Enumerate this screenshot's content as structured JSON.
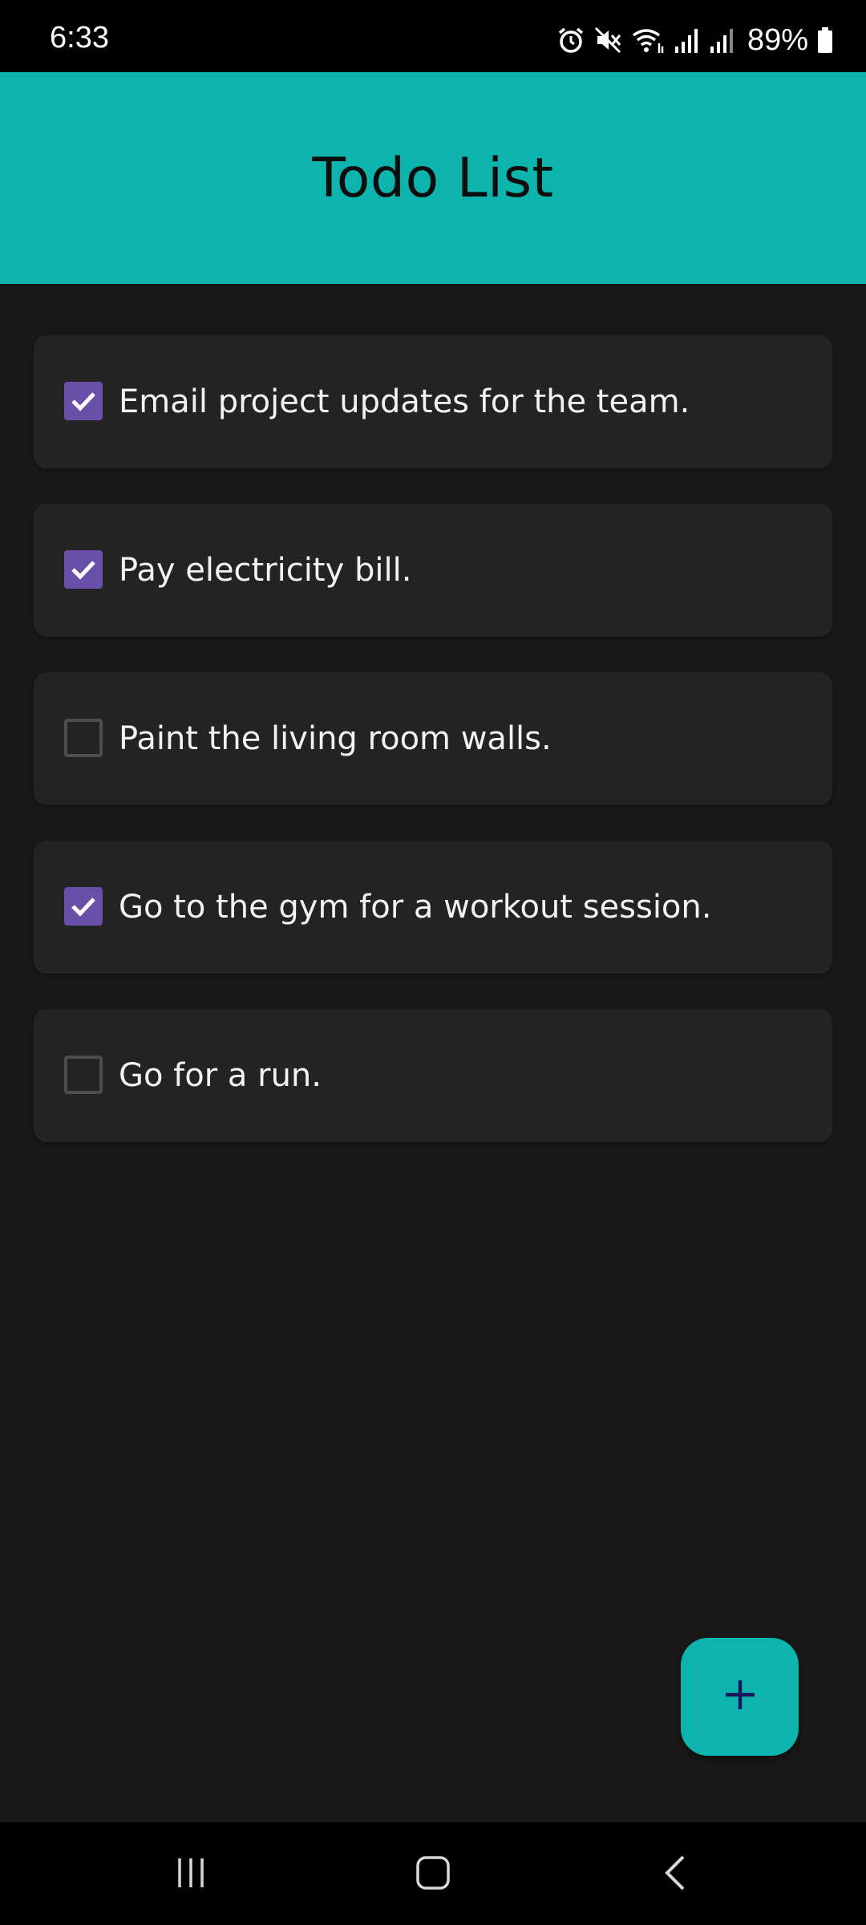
{
  "status_bar": {
    "time": "6:33",
    "battery": "89%",
    "icons": [
      "alarm-icon",
      "mute-icon",
      "wifi-icon",
      "signal-icon",
      "signal-icon",
      "battery-icon"
    ]
  },
  "app_bar": {
    "title": "Todo List"
  },
  "todos": [
    {
      "text": "Email project updates for the team.",
      "checked": true
    },
    {
      "text": "Pay electricity bill.",
      "checked": true
    },
    {
      "text": "Paint the living room walls.",
      "checked": false
    },
    {
      "text": "Go to the gym for a workout session.",
      "checked": true
    },
    {
      "text": "Go for a run.",
      "checked": false
    }
  ],
  "fab": {
    "icon": "plus-icon"
  },
  "nav_bar": {
    "buttons": [
      "recent-apps-icon",
      "home-icon",
      "back-icon"
    ]
  },
  "colors": {
    "accent": "#0cb4ad",
    "checkbox_checked": "#6a4fa8",
    "background": "#181818",
    "card": "#232323"
  }
}
